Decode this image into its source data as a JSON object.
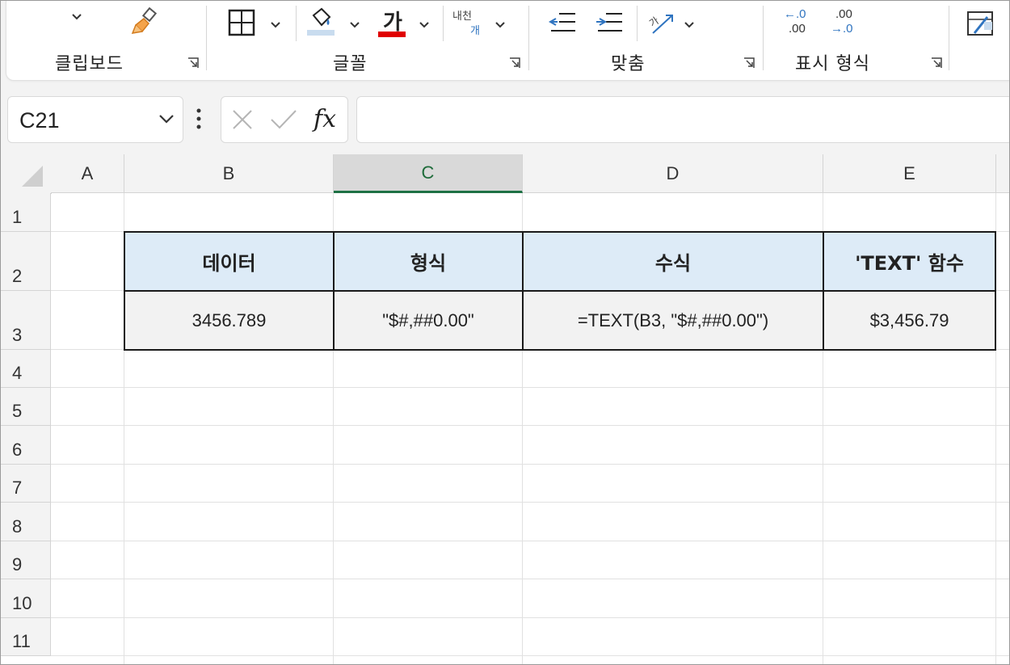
{
  "ribbon": {
    "groups": [
      {
        "label": "클립보드"
      },
      {
        "label": "글꼴"
      },
      {
        "label": "맞춤"
      },
      {
        "label": "표시 형식"
      }
    ],
    "font_color_glyph": "가",
    "wrap_text_glyph_top": "내천",
    "wrap_text_glyph_bottom": "개",
    "inc_decimal_top": "←.0",
    "inc_decimal_bottom": ".00",
    "dec_decimal_top": ".00",
    "dec_decimal_bottom": "→.0",
    "font_color_accent": "#e00000",
    "fill_color_accent": "#c9dcef",
    "icons": [
      "chevron-down-icon",
      "format-painter-icon",
      "borders-icon",
      "fill-color-icon",
      "font-color-icon",
      "wrap-text-icon",
      "decrease-indent-icon",
      "increase-indent-icon",
      "orientation-icon",
      "increase-decimal-icon",
      "decrease-decimal-icon",
      "conditional-format-icon"
    ]
  },
  "formula_bar": {
    "name_box": "C21",
    "fx": "fx",
    "formula": ""
  },
  "sheet": {
    "columns": [
      "A",
      "B",
      "C",
      "D",
      "E"
    ],
    "selected_column": "C",
    "rows": [
      "1",
      "2",
      "3",
      "4",
      "5",
      "6",
      "7",
      "8",
      "9",
      "10",
      "11"
    ],
    "table": {
      "headers": [
        "데이터",
        "형식",
        "수식",
        "'TEXT' 함수"
      ],
      "row": [
        "3456.789",
        "\"$#,##0.00\"",
        "=TEXT(B3, \"$#,##0.00\")",
        "$3,456.79"
      ]
    },
    "header_fill": "#ddebf7",
    "data_fill": "#f2f2f2",
    "selection_accent": "#1e7145"
  }
}
